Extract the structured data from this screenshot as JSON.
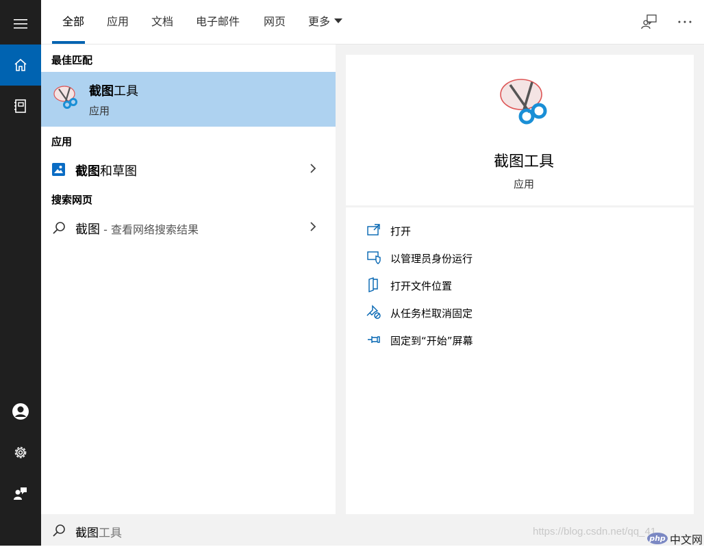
{
  "tabs": [
    {
      "label": "全部",
      "active": true
    },
    {
      "label": "应用"
    },
    {
      "label": "文档"
    },
    {
      "label": "电子邮件"
    },
    {
      "label": "网页"
    },
    {
      "label": "更多"
    }
  ],
  "icons": {
    "menu": "hamburger-icon",
    "home": "home-icon",
    "notebook": "notebook-icon",
    "account": "account-icon",
    "settings": "gear-icon",
    "feedback": "feedback-icon",
    "more": "ellipsis-icon",
    "search": "search-icon"
  },
  "colors": {
    "accent": "#0063b1",
    "selection": "#aed2f0",
    "sidebar": "#1f1f1f"
  },
  "left": {
    "best_match_heading": "最佳匹配",
    "best_match": {
      "title_bold": "截图",
      "title_rest": "工具",
      "subtitle": "应用"
    },
    "apps_heading": "应用",
    "app_item": {
      "title_bold": "截图",
      "title_rest": "和草图"
    },
    "web_heading": "搜索网页",
    "web_item": {
      "term": "截图",
      "hint": " - 查看网络搜索结果"
    }
  },
  "detail": {
    "title": "截图工具",
    "subtitle": "应用"
  },
  "actions": [
    {
      "label": "打开",
      "icon": "open-icon"
    },
    {
      "label": "以管理员身份运行",
      "icon": "shield-icon"
    },
    {
      "label": "打开文件位置",
      "icon": "file-location-icon"
    },
    {
      "label": "从任务栏取消固定",
      "icon": "unpin-icon"
    },
    {
      "label": "固定到“开始”屏幕",
      "icon": "pin-icon"
    }
  ],
  "search": {
    "typed": "截图",
    "suggestion": "工具"
  },
  "watermark": {
    "url": "https://blog.csdn.net/qq_41...",
    "brand_logo": "php",
    "brand_text": "中文网"
  }
}
